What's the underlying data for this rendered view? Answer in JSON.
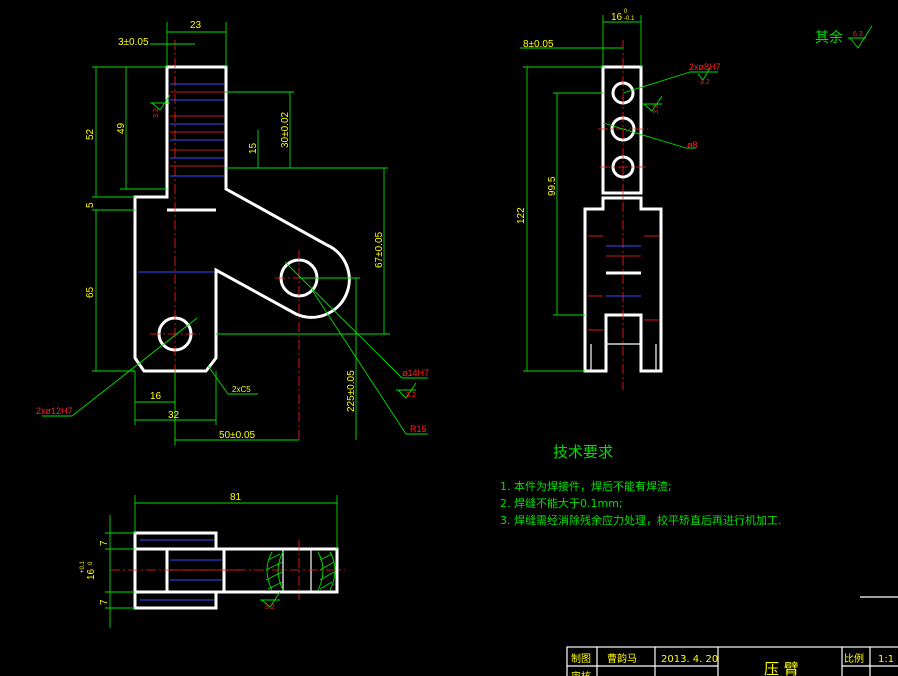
{
  "front_view": {
    "dim_23": "23",
    "dim_3": "3±0.05",
    "dim_52": "52",
    "dim_49": "49",
    "dim_5": "5",
    "dim_65": "65",
    "dim_30": "30±0.02",
    "dim_15": "15",
    "dim_67": "67±0.05",
    "dim_16": "16",
    "dim_32": "32",
    "dim_50": "50±0.05",
    "dim_225": "225±0.05",
    "dim_2xc5": "2xC5",
    "label_hole12": "2xø12H7",
    "label_hole14": "ø14H7",
    "label_r15": "R15",
    "rough_1": "3.2",
    "rough_2": "3.2"
  },
  "side_view": {
    "dim_16": "16",
    "dim_16_tol": "0",
    "dim_16_tol2": "-0.1",
    "dim_8": "8±0.05",
    "dim_122": "122",
    "dim_995": "99.5",
    "label_hole8h7": "2xø8H7",
    "label_hole8": "ø8",
    "rough_1": "3.2",
    "rough_2": "3.2"
  },
  "top_view": {
    "dim_81": "81",
    "dim_7a": "7",
    "dim_7b": "7",
    "dim_16": "16",
    "dim_16_tol": "+0.1",
    "dim_16_tol2": "0",
    "rough": "3.2"
  },
  "surface_mark": {
    "label": "其余",
    "value": "6.3"
  },
  "notes": {
    "title": "技术要求",
    "items": [
      "1. 本件为焊接件，焊后不能有焊渣;",
      "2. 焊缝不能大于0.1mm;",
      "3. 焊缝需经消除残余应力处理，校平矫直后再进行机加工."
    ]
  },
  "title_block": {
    "row1_label": "制图",
    "row1_name": "曹韵马",
    "row1_date": "2013. 4. 20",
    "row2_label": "审核",
    "part_name": "压   臂",
    "scale_label": "比例",
    "scale_value": "1:1"
  }
}
